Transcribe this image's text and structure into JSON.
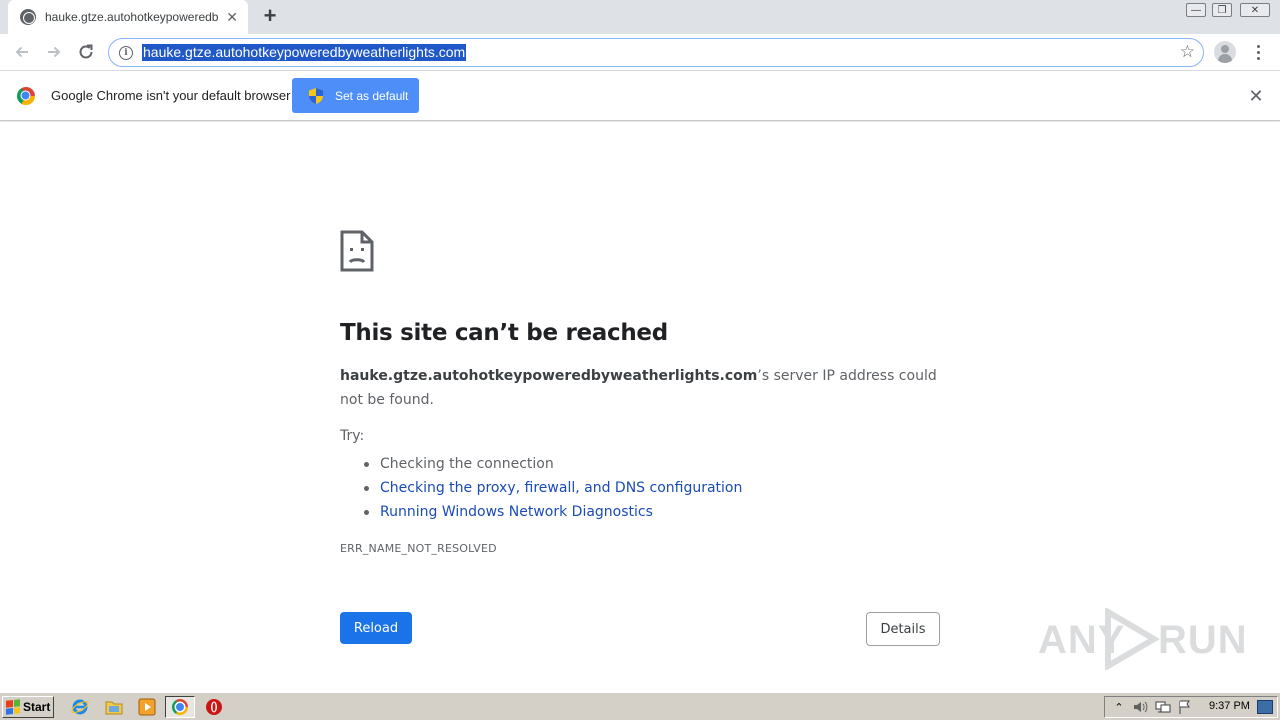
{
  "browser": {
    "tab": {
      "title": "hauke.gtze.autohotkeypoweredbyweatherlights.com",
      "close_glyph": "✕"
    },
    "new_tab_glyph": "+",
    "address_bar": {
      "url": "hauke.gtze.autohotkeypoweredbyweatherlights.com",
      "info_glyph": "i",
      "bookmark_glyph": "☆"
    },
    "window_controls": {
      "minimize_glyph": "—",
      "restore_glyph": "❐",
      "close_glyph": "✕"
    }
  },
  "infobar": {
    "message": "Google Chrome isn't your default browser",
    "button_label": "Set as default",
    "close_glyph": "✕"
  },
  "error_page": {
    "title": "This site can’t be reached",
    "host": "hauke.gtze.autohotkeypoweredbyweatherlights.com",
    "description_rest": "’s server IP address could not be found.",
    "try_label": "Try:",
    "suggestions": [
      {
        "text": "Checking the connection",
        "is_link": false
      },
      {
        "text": "Checking the proxy, firewall, and DNS configuration",
        "is_link": true
      },
      {
        "text": "Running Windows Network Diagnostics",
        "is_link": true
      }
    ],
    "error_code": "ERR_NAME_NOT_RESOLVED",
    "reload_label": "Reload",
    "details_label": "Details"
  },
  "watermark": {
    "left_text": "ANY",
    "right_text": "RUN"
  },
  "taskbar": {
    "start_label": "Start",
    "clock": "9:37 PM",
    "tray_expand_glyph": "⌃"
  },
  "colors": {
    "accent_blue": "#1a73e8",
    "link_blue": "#1a4cb5",
    "infobar_button": "#4d8ef8",
    "url_selection": "#2058c8"
  }
}
